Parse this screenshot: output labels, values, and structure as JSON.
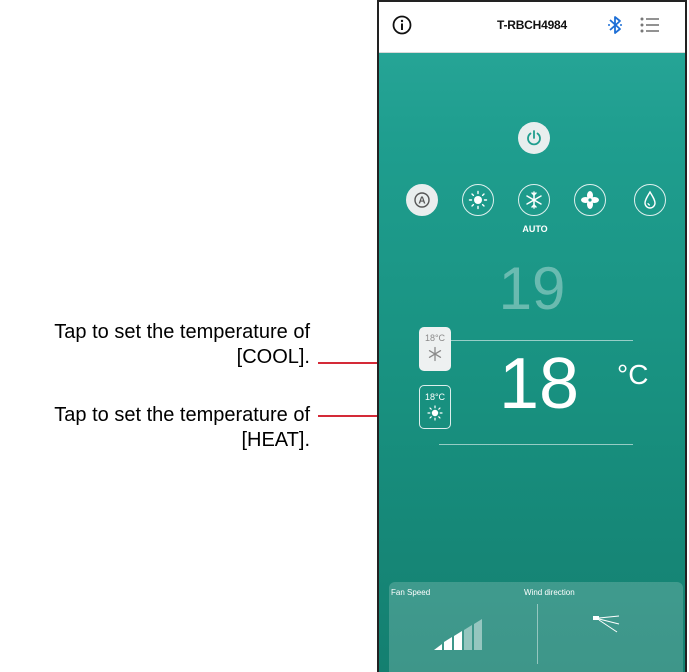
{
  "callouts": {
    "cool_line1": "Tap to set the temperature of",
    "cool_line2": "[COOL].",
    "heat_line1": "Tap to set the temperature of",
    "heat_line2": "[HEAT]."
  },
  "header": {
    "device_name": "T-RBCH4984",
    "icons": [
      "info-icon",
      "bluetooth-icon",
      "menu-icon"
    ]
  },
  "modes": {
    "items": [
      "auto-mode-icon",
      "heat-mode-icon",
      "cool-mode-icon",
      "fan-mode-icon",
      "dry-mode-icon"
    ],
    "selected": "auto-mode-icon",
    "label": "AUTO"
  },
  "temperature": {
    "previous": "19",
    "setpoint": "18",
    "unit": "°C"
  },
  "temp_tabs": {
    "cool_value": "18°C",
    "heat_value": "18°C"
  },
  "bottom": {
    "fan_speed_label": "Fan Speed",
    "wind_direction_label": "Wind direction"
  },
  "colors": {
    "accent": "#1f9e8f",
    "leader": "#d42a38",
    "bluetooth": "#1e6fd6"
  }
}
